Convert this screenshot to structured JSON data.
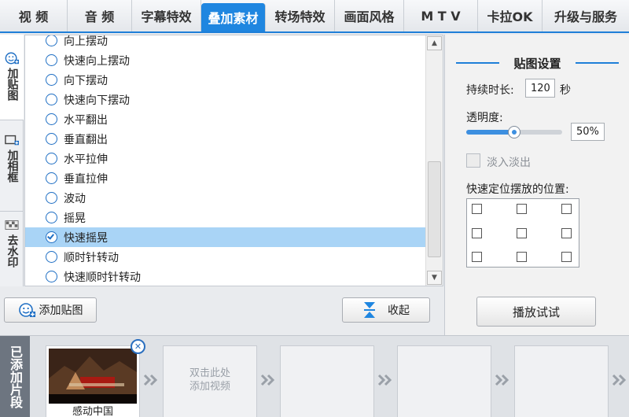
{
  "top_tabs": [
    {
      "label": "视 频",
      "active": false
    },
    {
      "label": "音 频",
      "active": false
    },
    {
      "label": "字幕特效",
      "active": false
    },
    {
      "label": "叠加素材",
      "active": true
    },
    {
      "label": "转场特效",
      "active": false
    },
    {
      "label": "画面风格",
      "active": false
    },
    {
      "label": "M T V",
      "active": false
    },
    {
      "label": "卡拉OK",
      "active": false
    },
    {
      "label": "升级与服务",
      "active": false
    }
  ],
  "side_tabs": [
    {
      "label": "加贴图",
      "icon": "sticker-add-icon",
      "active": true
    },
    {
      "label": "加相框",
      "icon": "frame-add-icon",
      "active": false
    },
    {
      "label": "去水印",
      "icon": "watermark-remove-icon",
      "active": false
    }
  ],
  "effects": {
    "items": [
      "向上摆动",
      "快速向上摆动",
      "向下摆动",
      "快速向下摆动",
      "水平翻出",
      "垂直翻出",
      "水平拉伸",
      "垂直拉伸",
      "波动",
      "摇晃",
      "快速摇晃",
      "顺时针转动",
      "快速顺时针转动"
    ],
    "selected": "快速摇晃"
  },
  "buttons": {
    "add_sticker": "添加贴图",
    "collapse": "收起",
    "play_preview": "播放试试"
  },
  "settings": {
    "title": "贴图设置",
    "duration_label": "持续时长:",
    "duration_value": "120",
    "duration_unit": "秒",
    "opacity_label": "透明度:",
    "opacity_value": "50%",
    "opacity_fraction": 0.5,
    "fade_label": "淡入淡出",
    "fade_checked": false,
    "position_label": "快速定位摆放的位置:"
  },
  "clips": {
    "strip_label": "已添加片段",
    "items": [
      {
        "name": "感动中国",
        "filled": true
      },
      {
        "hint": "双击此处添加视频",
        "filled": false
      },
      {
        "filled": false
      },
      {
        "filled": false
      },
      {
        "filled": false
      }
    ]
  }
}
